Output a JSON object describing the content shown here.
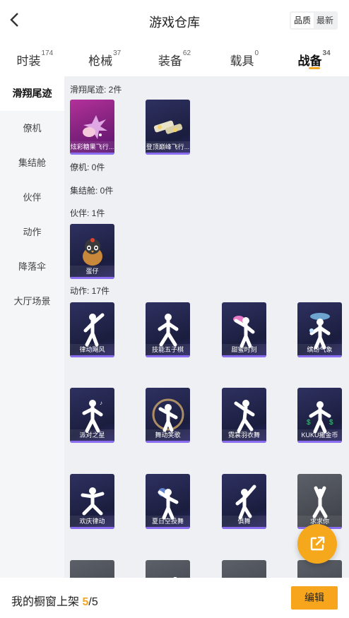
{
  "header": {
    "title": "游戏仓库",
    "sort": [
      "品质",
      "最新"
    ]
  },
  "tabs": [
    {
      "label": "时装",
      "count": "174"
    },
    {
      "label": "枪械",
      "count": "37"
    },
    {
      "label": "装备",
      "count": "62"
    },
    {
      "label": "载具",
      "count": "0"
    },
    {
      "label": "战备",
      "count": "34"
    }
  ],
  "sidebar": {
    "items": [
      "滑翔尾迹",
      "僚机",
      "集结舱",
      "伙伴",
      "动作",
      "降落伞",
      "大厅场景"
    ]
  },
  "sections": {
    "trail": "滑翔尾迹: 2件",
    "wingman": "僚机: 0件",
    "capsule": "集结舱: 0件",
    "partner": "伙伴: 1件",
    "emote": "动作: 17件"
  },
  "cards": {
    "trail": [
      "炫彩糖果飞行...",
      "登顶巅峰飞行..."
    ],
    "partner": [
      "蛋仔"
    ],
    "emote": [
      "律动飓风",
      "技能五子棋",
      "甜蜜时刻",
      "缤纷气象",
      "派对之星",
      "舞动笑歌",
      "霓裳羽衣舞",
      "KUKU撒金币",
      "欢庆律动",
      "夏日空投舞",
      "俱舞",
      "求求你"
    ]
  },
  "bottom": {
    "shelf_label": "我的橱窗上架",
    "shelf_current": "5",
    "shelf_total": "/5",
    "edit_label": "编辑"
  },
  "colors": {
    "accent": "#f5a623",
    "card_bar": "#8a6cf0"
  }
}
